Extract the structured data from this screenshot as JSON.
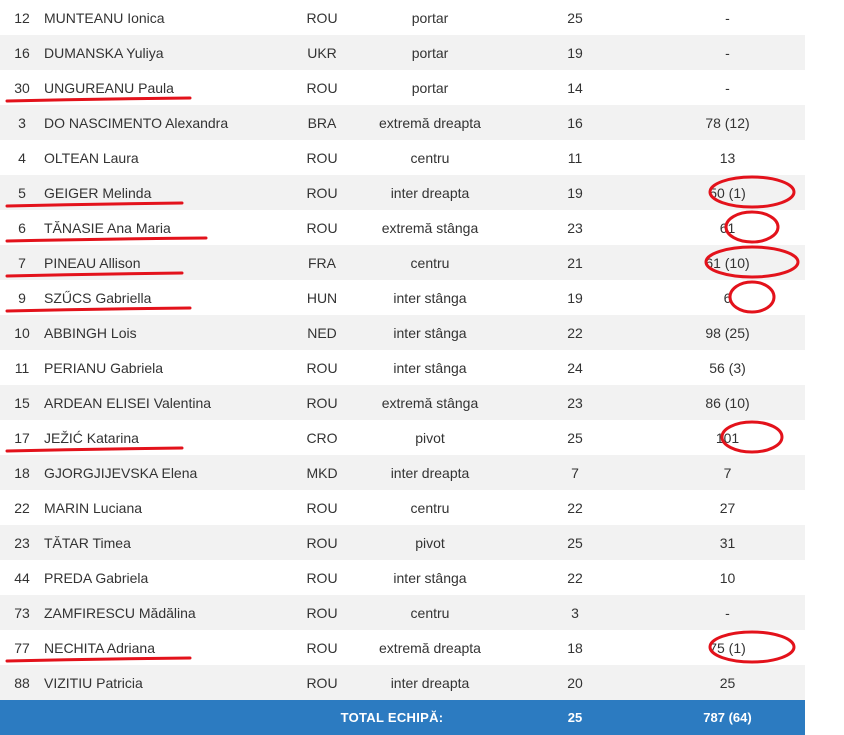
{
  "players": [
    {
      "number": "12",
      "name": "MUNTEANU Ionica",
      "nationality": "ROU",
      "position": "portar",
      "appearances": "25",
      "goals": "-"
    },
    {
      "number": "16",
      "name": "DUMANSKA Yuliya",
      "nationality": "UKR",
      "position": "portar",
      "appearances": "19",
      "goals": "-"
    },
    {
      "number": "30",
      "name": "UNGUREANU Paula",
      "nationality": "ROU",
      "position": "portar",
      "appearances": "14",
      "goals": "-"
    },
    {
      "number": "3",
      "name": "DO NASCIMENTO Alexandra",
      "nationality": "BRA",
      "position": "extremă dreapta",
      "appearances": "16",
      "goals": "78 (12)"
    },
    {
      "number": "4",
      "name": "OLTEAN Laura",
      "nationality": "ROU",
      "position": "centru",
      "appearances": "11",
      "goals": "13"
    },
    {
      "number": "5",
      "name": "GEIGER Melinda",
      "nationality": "ROU",
      "position": "inter dreapta",
      "appearances": "19",
      "goals": "50 (1)"
    },
    {
      "number": "6",
      "name": "TĂNASIE Ana Maria",
      "nationality": "ROU",
      "position": "extremă stânga",
      "appearances": "23",
      "goals": "61"
    },
    {
      "number": "7",
      "name": "PINEAU Allison",
      "nationality": "FRA",
      "position": "centru",
      "appearances": "21",
      "goals": "61 (10)"
    },
    {
      "number": "9",
      "name": "SZŰCS Gabriella",
      "nationality": "HUN",
      "position": "inter stânga",
      "appearances": "19",
      "goals": "6"
    },
    {
      "number": "10",
      "name": "ABBINGH Lois",
      "nationality": "NED",
      "position": "inter stânga",
      "appearances": "22",
      "goals": "98 (25)"
    },
    {
      "number": "11",
      "name": "PERIANU Gabriela",
      "nationality": "ROU",
      "position": "inter stânga",
      "appearances": "24",
      "goals": "56 (3)"
    },
    {
      "number": "15",
      "name": "ARDEAN ELISEI Valentina",
      "nationality": "ROU",
      "position": "extremă stânga",
      "appearances": "23",
      "goals": "86 (10)"
    },
    {
      "number": "17",
      "name": "JEŽIĆ Katarina",
      "nationality": "CRO",
      "position": "pivot",
      "appearances": "25",
      "goals": "101"
    },
    {
      "number": "18",
      "name": "GJORGJIJEVSKA Elena",
      "nationality": "MKD",
      "position": "inter dreapta",
      "appearances": "7",
      "goals": "7"
    },
    {
      "number": "22",
      "name": "MARIN Luciana",
      "nationality": "ROU",
      "position": "centru",
      "appearances": "22",
      "goals": "27"
    },
    {
      "number": "23",
      "name": "TĂTAR Timea",
      "nationality": "ROU",
      "position": "pivot",
      "appearances": "25",
      "goals": "31"
    },
    {
      "number": "44",
      "name": "PREDA Gabriela",
      "nationality": "ROU",
      "position": "inter stânga",
      "appearances": "22",
      "goals": "10"
    },
    {
      "number": "73",
      "name": "ZAMFIRESCU Mădălina",
      "nationality": "ROU",
      "position": "centru",
      "appearances": "3",
      "goals": "-"
    },
    {
      "number": "77",
      "name": "NECHITA Adriana",
      "nationality": "ROU",
      "position": "extremă dreapta",
      "appearances": "18",
      "goals": "75 (1)"
    },
    {
      "number": "88",
      "name": "VIZITIU Patricia",
      "nationality": "ROU",
      "position": "inter dreapta",
      "appearances": "20",
      "goals": "25"
    }
  ],
  "total": {
    "label": "TOTAL ECHIPĂ:",
    "appearances": "25",
    "goals": "787 (64)"
  },
  "annotations": {
    "underlined_rows": [
      2,
      5,
      6,
      7,
      8,
      12,
      18
    ],
    "circled_goal_rows": [
      5,
      6,
      7,
      8,
      12,
      18
    ],
    "color": "#e3121b"
  },
  "colors": {
    "row_alt": "#f2f2f2",
    "row": "#ffffff",
    "total_bar": "#2c7bc1",
    "total_text": "#ffffff"
  }
}
